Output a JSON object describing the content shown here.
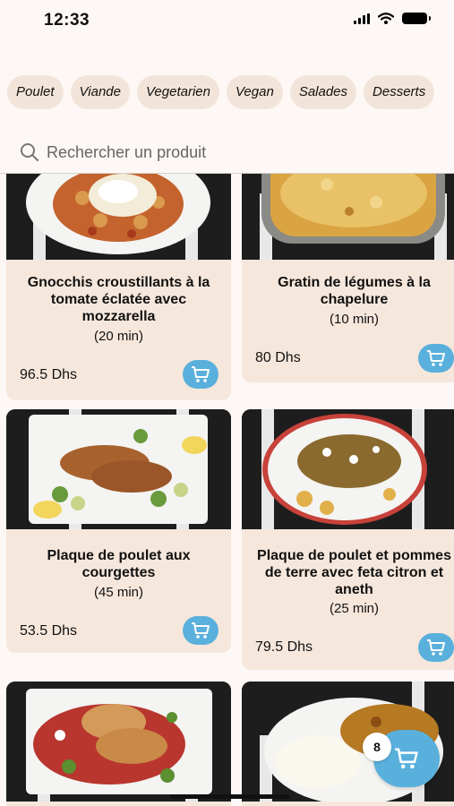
{
  "status_bar": {
    "time": "12:33"
  },
  "categories": [
    "Poulet",
    "Viande",
    "Vegetarien",
    "Vegan",
    "Salades",
    "Desserts"
  ],
  "search": {
    "placeholder": "Rechercher un produit"
  },
  "products": [
    {
      "title": "Gnocchis croustillants à la tomate éclatée avec mozzarella",
      "time": "(20 min)",
      "price": "96.5 Dhs"
    },
    {
      "title": "Gratin de légumes à la chapelure",
      "time": "(10 min)",
      "price": "80 Dhs"
    },
    {
      "title": "Plaque de poulet aux courgettes",
      "time": "(45 min)",
      "price": "53.5 Dhs"
    },
    {
      "title": "Plaque de poulet et pommes de terre avec feta citron et aneth",
      "time": "(25 min)",
      "price": "79.5 Dhs"
    }
  ],
  "cart": {
    "count": "8"
  },
  "colors": {
    "accent": "#5ab0dc",
    "card": "#f6e7dc",
    "chip": "#f3e4d9",
    "background": "#fdf8f5"
  }
}
